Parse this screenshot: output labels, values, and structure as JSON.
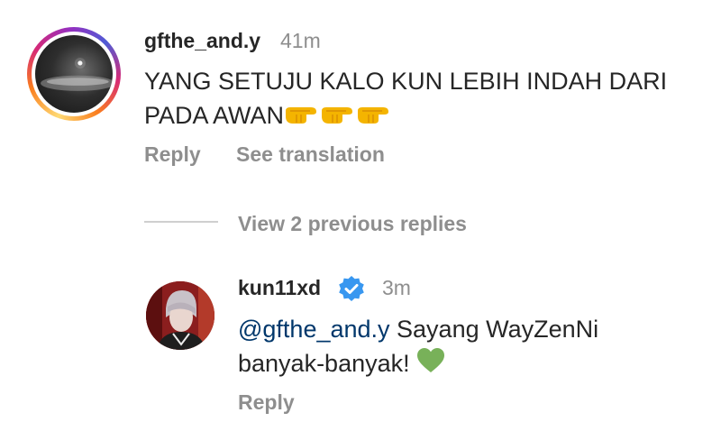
{
  "comment": {
    "username": "gfthe_and.y",
    "time": "41m",
    "text_line1": "YANG SETUJU KALO KUN LEBIH INDAH DARI",
    "text_line2": "PADA AWAN",
    "emoji_icons": [
      "pointing-right-emoji",
      "pointing-right-emoji",
      "pointing-right-emoji"
    ],
    "reply_label": "Reply",
    "translation_label": "See translation"
  },
  "replies_toggle": {
    "label": "View 2 previous replies"
  },
  "reply": {
    "username": "kun11xd",
    "verified": true,
    "time": "3m",
    "mention": "@gfthe_and.y",
    "text_line1": " Sayang WayZenNi",
    "text_line2": "banyak-banyak!",
    "emoji_icon": "green-heart-emoji",
    "reply_label": "Reply"
  },
  "colors": {
    "text": "#262626",
    "muted": "#8e8e8e",
    "mention": "#00376b",
    "verified": "#3897f0",
    "heart": "#78b159"
  }
}
